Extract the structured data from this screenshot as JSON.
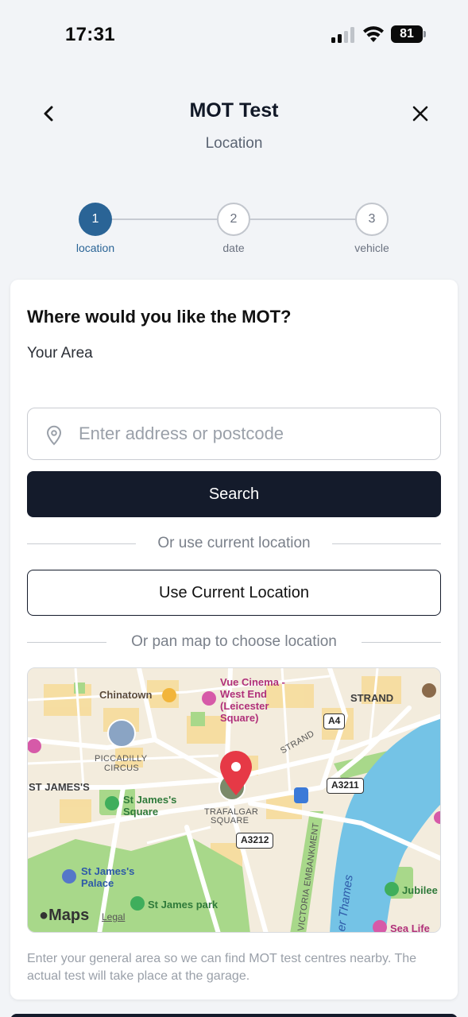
{
  "status_bar": {
    "time": "17:31",
    "battery": "81"
  },
  "header": {
    "title": "MOT Test",
    "subtitle": "Location"
  },
  "stepper": {
    "steps": [
      {
        "number": "1",
        "label": "location",
        "active": true
      },
      {
        "number": "2",
        "label": "date",
        "active": false
      },
      {
        "number": "3",
        "label": "vehicle",
        "active": false
      }
    ]
  },
  "form": {
    "heading": "Where would you like the MOT?",
    "area_label": "Your Area",
    "address_input": {
      "placeholder": "Enter address or postcode",
      "value": ""
    },
    "search_label": "Search",
    "divider_current": "Or use current location",
    "current_location_label": "Use Current Location",
    "divider_map": "Or pan map to choose location",
    "help_text": "Enter your general area so we can find MOT test centres nearby. The actual test will take place at the garage."
  },
  "map": {
    "labels": {
      "chinatown": "Chinatown",
      "vue_1": "Vue Cinema -",
      "vue_2": "West End",
      "vue_3": "(Leicester",
      "vue_4": "Square)",
      "strand_top": "STRAND",
      "strand_diag": "STRAND",
      "piccadilly_1": "PICCADILLY",
      "piccadilly_2": "CIRCUS",
      "st_james_s": "ST JAMES'S",
      "st_james_sq_1": "St James's",
      "st_james_sq_2": "Square",
      "trafalgar_1": "TRAFALGAR",
      "trafalgar_2": "SQUARE",
      "st_james_palace_1": "St James's",
      "st_james_palace_2": "Palace",
      "st_james_park": "St James park",
      "victoria_embankment": "VICTORIA EMBANKMENT",
      "thames": "er Thames",
      "jubilee": "Jubilee",
      "sea_life": "Sea Life",
      "maps_logo": "Maps",
      "legal": "Legal"
    },
    "road_badges": {
      "a4": "A4",
      "a3211": "A3211",
      "a3212": "A3212"
    }
  },
  "colors": {
    "accent": "#2a6496",
    "primary_button": "#141b2b",
    "water": "#74c3e6",
    "park": "#a8d88a",
    "pin": "#e63946"
  }
}
